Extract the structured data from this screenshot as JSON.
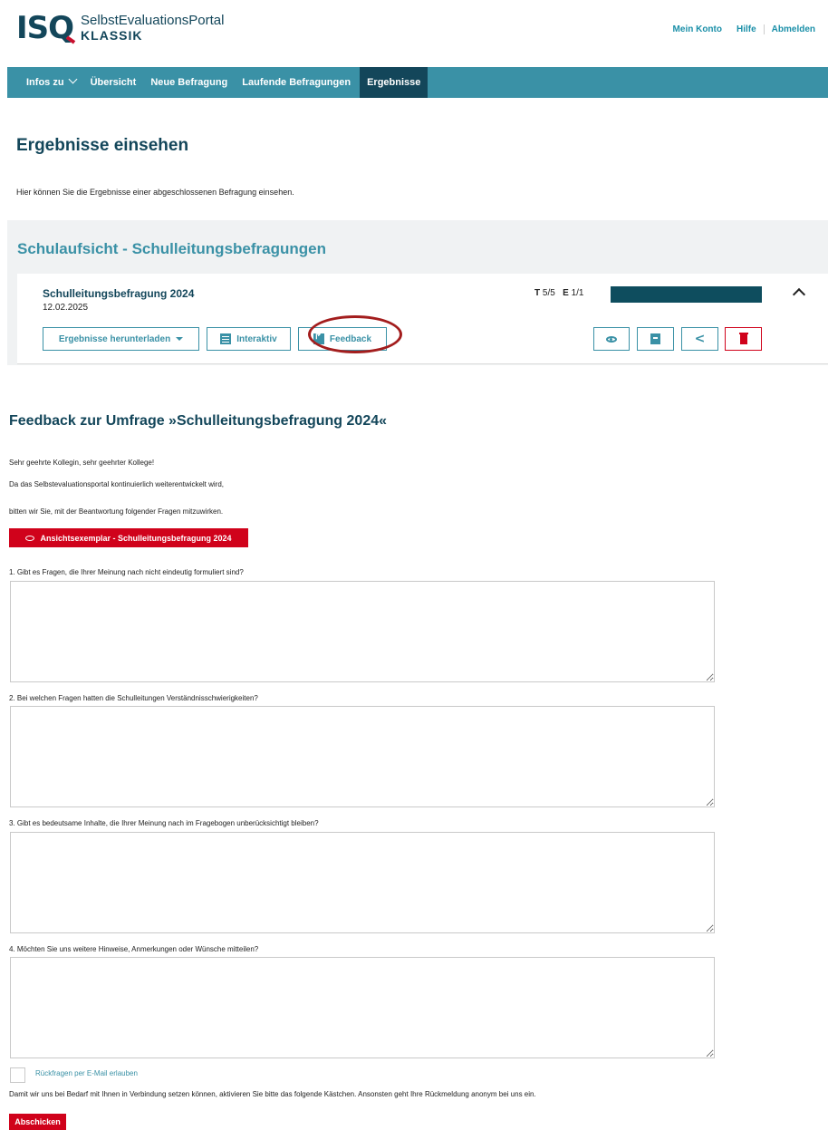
{
  "header": {
    "logo_mark": "ISQ",
    "logo_line1": "SelbstEvaluationsPortal",
    "logo_line2": "KLASSIK",
    "links": [
      "Mein Konto",
      "Hilfe",
      "Abmelden"
    ]
  },
  "nav": {
    "items": [
      "Infos zu",
      "Übersicht",
      "Neue Befragung",
      "Laufende Befragungen",
      "Ergebnisse"
    ],
    "active": "Ergebnisse"
  },
  "page": {
    "title": "Ergebnisse einsehen",
    "intro": "Hier können Sie die Ergebnisse einer abgeschlossenen Befragung einsehen."
  },
  "group": {
    "title": "Schulaufsicht - Schulleitungsbefragungen",
    "survey": {
      "name": "Schulleitungsbefragung 2024",
      "date": "12.02.2025",
      "t_label": "T",
      "t_value": "5/5",
      "e_label": "E",
      "e_value": "1/1",
      "progress": 1.0,
      "buttons": {
        "download": "Ergebnisse herunterladen",
        "interactive": "Interaktiv",
        "feedback": "Feedback"
      },
      "icons": [
        "eye-icon",
        "copy-icon",
        "share-icon",
        "trash-icon"
      ]
    }
  },
  "feedback": {
    "title": "Feedback zur Umfrage »Schulleitungsbefragung 2024«",
    "greeting": "Sehr geehrte Kollegin, sehr geehrter Kollege!",
    "para1": "Da das Selbstevaluationsportal kontinuierlich weiterentwickelt wird,",
    "para2": "bitten wir Sie, mit der Beantwortung folgender Fragen mitzuwirken.",
    "preview_button": "Ansichtsexemplar - Schulleitungsbefragung 2024",
    "questions": [
      "1. Gibt es Fragen, die Ihrer Meinung nach nicht eindeutig formuliert sind?",
      "2. Bei welchen Fragen hatten die Schulleitungen Verständnisschwierigkeiten?",
      "3. Gibt es bedeutsame Inhalte, die Ihrer Meinung nach im Fragebogen unberücksichtigt bleiben?",
      "4. Möchten Sie uns weitere Hinweise, Anmerkungen oder Wünsche mitteilen?"
    ],
    "answers": [
      "",
      "",
      "",
      ""
    ],
    "checkbox_label": "Rückfragen per E-Mail erlauben",
    "checkbox_checked": false,
    "note": "Damit wir uns bei Bedarf mit Ihnen in Verbindung setzen können, aktivieren Sie bitte das folgende Kästchen. Ansonsten geht Ihre Rückmeldung anonym bei uns ein.",
    "submit": "Abschicken"
  },
  "colors": {
    "brand_dark": "#13465a",
    "nav_teal": "#3a91a6",
    "danger": "#d0021b",
    "progress": "#0e4d5e"
  }
}
